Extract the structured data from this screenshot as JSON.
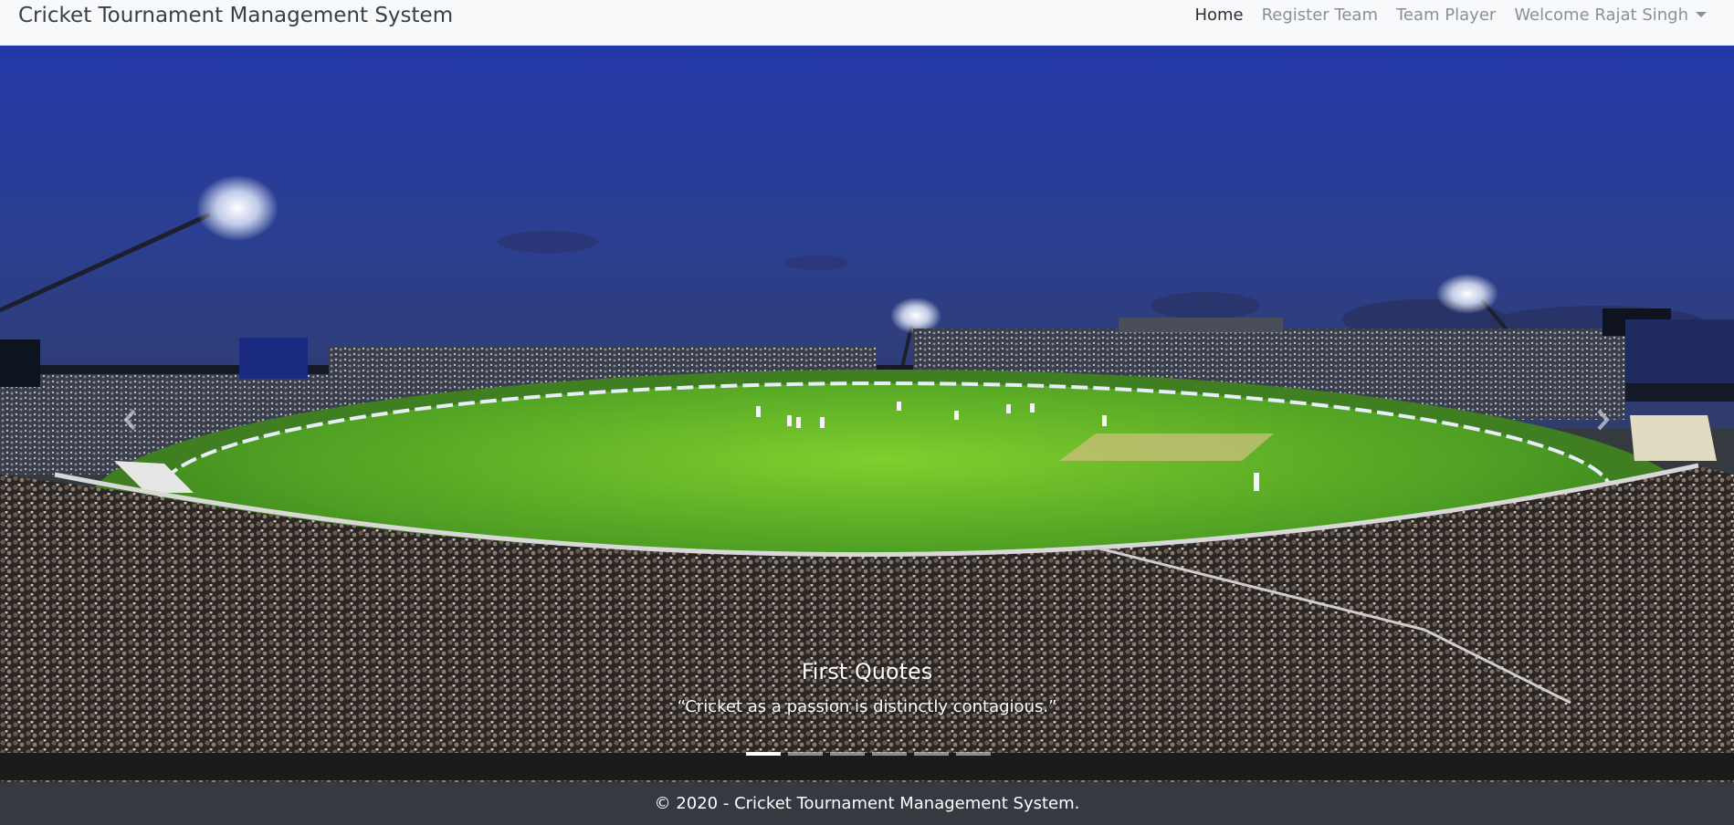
{
  "navbar": {
    "brand": "Cricket Tournament Management System",
    "links": [
      {
        "label": "Home",
        "active": true
      },
      {
        "label": "Register Team",
        "active": false
      },
      {
        "label": "Team Player",
        "active": false
      }
    ],
    "user_menu_label": "Welcome Rajat Singh"
  },
  "carousel": {
    "image_icon": "stadium-night-image",
    "caption_title": "First Quotes",
    "caption_text": "“Cricket as a passion is distinctly contagious.”",
    "slide_count": 6,
    "active_slide": 1,
    "prev_icon": "chevron-left-icon",
    "next_icon": "chevron-right-icon"
  },
  "footer": {
    "text": "© 2020 - Cricket Tournament Management System."
  },
  "colors": {
    "navbar_bg": "#f8f9fa",
    "footer_bg": "#343a40",
    "sky": "#2a3d9a",
    "field": "#4c9a28"
  }
}
